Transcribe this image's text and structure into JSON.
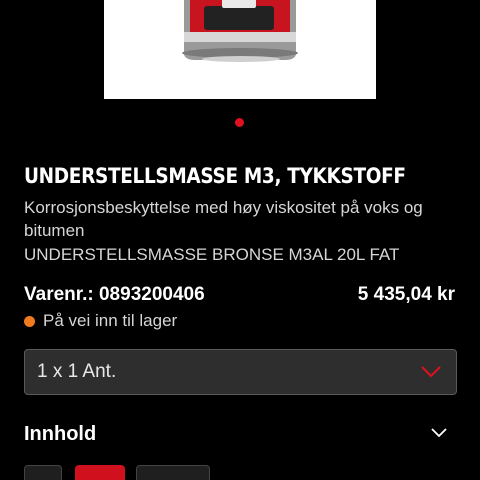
{
  "product": {
    "title": "UNDERSTELLSMASSE M3, TYKKSTOFF",
    "description": "Korrosjonsbeskyttelse med høy viskositet på voks og bitumen",
    "subtitle": "UNDERSTELLSMASSE BRONSE M3AL 20L FAT",
    "sku": "Varenr.: 0893200406",
    "price": "5 435,04 kr",
    "stock_status": "På vei inn til lager"
  },
  "carousel": {
    "active_dot_color": "#e0101e"
  },
  "quantity": {
    "selected": "1 x 1 Ant."
  },
  "section": {
    "title": "Innhold"
  },
  "colors": {
    "accent": "#e0101e",
    "stock_dot": "#f07a1d",
    "background": "#000000"
  },
  "icons": {
    "qty_dropdown": "chevron-down-icon",
    "section_toggle": "chevron-down-icon"
  }
}
